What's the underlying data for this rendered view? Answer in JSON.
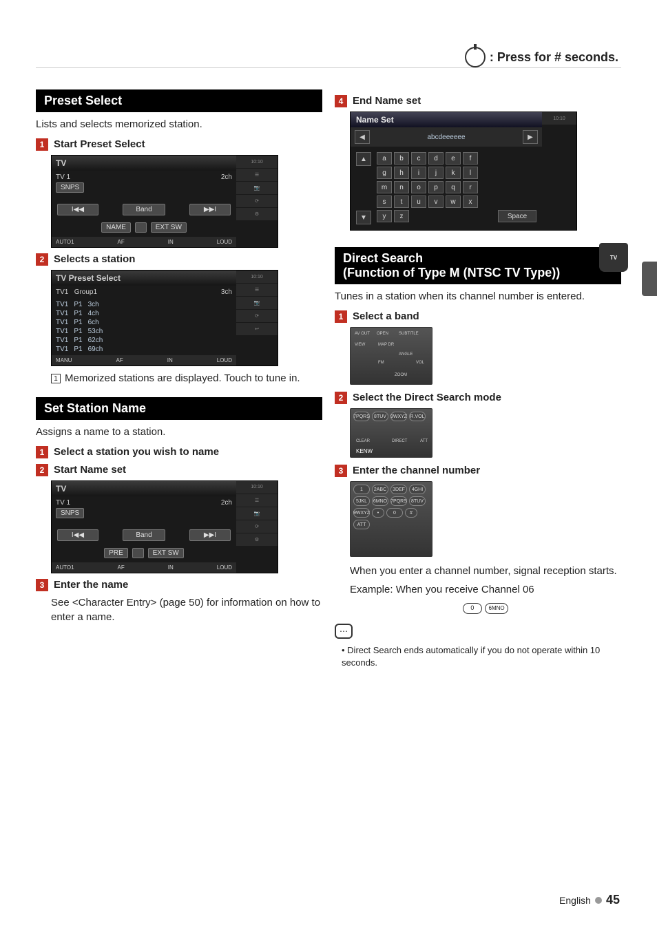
{
  "topHint": ": Press for # seconds.",
  "presetSelect": {
    "title": "Preset Select",
    "intro": "Lists and selects memorized station.",
    "step1": "Start Preset Select",
    "screenshot1": {
      "title": "TV",
      "line1_left": "TV 1",
      "line1_right": "2ch",
      "snps": "SNPS",
      "band": "Band",
      "name": "NAME",
      "extsw": "EXT SW",
      "auto": "AUTO1",
      "af": "AF",
      "in": "IN",
      "loud": "LOUD",
      "clock": "10:10"
    },
    "step2": "Selects a station",
    "screenshot2": {
      "title": "TV Preset Select",
      "hdr_left": "TV1",
      "hdr_group": "Group1",
      "hdr_right": "3ch",
      "rows": [
        {
          "c1": "TV1",
          "c2": "P1",
          "c3": "3ch"
        },
        {
          "c1": "TV1",
          "c2": "P1",
          "c3": "4ch"
        },
        {
          "c1": "TV1",
          "c2": "P1",
          "c3": "6ch"
        },
        {
          "c1": "TV1",
          "c2": "P1",
          "c3": "53ch"
        },
        {
          "c1": "TV1",
          "c2": "P1",
          "c3": "62ch"
        },
        {
          "c1": "TV1",
          "c2": "P1",
          "c3": "69ch"
        }
      ],
      "manu": "MANU",
      "af": "AF",
      "in": "IN",
      "loud": "LOUD",
      "clock": "10:10"
    },
    "note1_num": "1",
    "note1_text": "Memorized stations are displayed. Touch to tune in."
  },
  "setStationName": {
    "title": "Set Station Name",
    "intro": "Assigns a name to a station.",
    "step1": "Select a station you wish to name",
    "step2": "Start Name set",
    "screenshot": {
      "title": "TV",
      "line1_left": "TV 1",
      "line1_right": "2ch",
      "snps": "SNPS",
      "band": "Band",
      "pre": "PRE",
      "extsw": "EXT SW",
      "auto": "AUTO1",
      "af": "AF",
      "in": "IN",
      "loud": "LOUD",
      "clock": "10:10"
    },
    "step3": "Enter the name",
    "step3_body": "See <Character Entry> (page 50) for information on how to enter a name."
  },
  "endNameSet": {
    "step4": "End Name set",
    "nsTitle": "Name Set",
    "nsInput": "abcdeeeeee",
    "keys": [
      [
        "a",
        "b",
        "c",
        "d",
        "e",
        "f"
      ],
      [
        "g",
        "h",
        "i",
        "j",
        "k",
        "l"
      ],
      [
        "m",
        "n",
        "o",
        "p",
        "q",
        "r"
      ],
      [
        "s",
        "t",
        "u",
        "v",
        "w",
        "x"
      ],
      [
        "y",
        "z"
      ]
    ],
    "space": "Space",
    "clock": "10:10"
  },
  "directSearch": {
    "title": "Direct Search",
    "subtitle": " (Function of Type M (NTSC TV Type))",
    "intro": "Tunes in a station when its channel number is entered.",
    "step1": "Select a band",
    "step2": "Select the Direct Search mode",
    "step3": "Enter the channel number",
    "afterEnter": "When you enter a channel number, signal reception starts.",
    "example": "Example: When you receive Channel 06",
    "tip": "Direct Search ends automatically if you do not operate within 10 seconds."
  },
  "remote": {
    "kenw": "KENW",
    "labels": {
      "avout": "AV OUT",
      "open": "OPEN",
      "subtitle": "SUBTITLE",
      "view": "VIEW",
      "mapdr": "MAP DR",
      "angle": "ANGLE",
      "fm": "FM",
      "vol": "VOL",
      "zoom": "ZOOM",
      "rvol": "R.VOL",
      "att": "ATT",
      "clear": "CLEAR",
      "direct": "DIRECT",
      "num0": "0",
      "nums": [
        "1",
        "2ABC",
        "3DEF",
        "4GHI",
        "5JKL",
        "6MNO",
        "7PQRS",
        "8TUV",
        "9WXYZ"
      ],
      "btn0": "0",
      "btn6": "6MNO"
    }
  },
  "footer": {
    "lang": "English",
    "page": "45"
  }
}
